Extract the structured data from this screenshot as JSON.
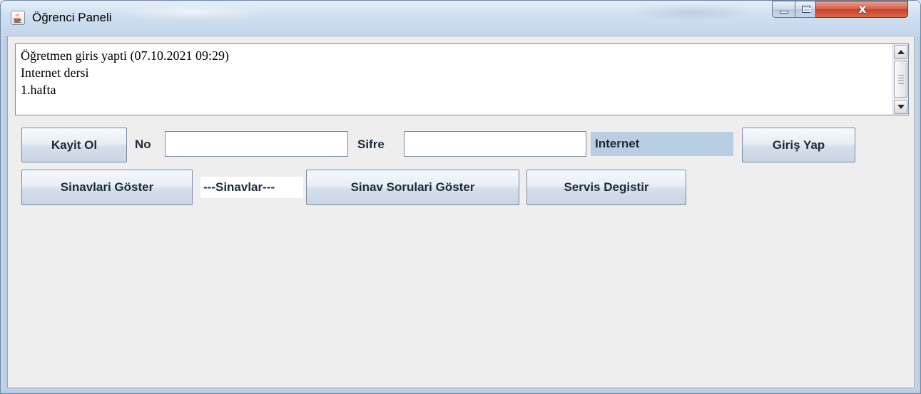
{
  "window": {
    "title": "Öğrenci Paneli",
    "app_icon": "java-cup-icon",
    "controls": [
      "minimize-icon",
      "maximize-icon",
      "close-icon"
    ],
    "close_glyph": "x"
  },
  "log": {
    "lines": [
      "Öğretmen giris yapti (07.10.2021 09:29)",
      "Internet dersi",
      "1.hafta"
    ]
  },
  "login_row": {
    "register_label": "Kayit Ol",
    "no_label": "No",
    "no_value": "",
    "password_label": "Sifre",
    "password_value": "",
    "service_name": "Internet",
    "login_label": "Giriş Yap"
  },
  "exam_row": {
    "show_exams_label": "Sinavlari Göster",
    "exams_selected": "---Sinavlar---",
    "show_questions_label": "Sinav Sorulari Göster",
    "change_service_label": "Servis Degistir"
  },
  "colors": {
    "client_bg": "#eeeeee",
    "service_badge_bg": "#b9cde3",
    "close_button": "#c8432a"
  }
}
